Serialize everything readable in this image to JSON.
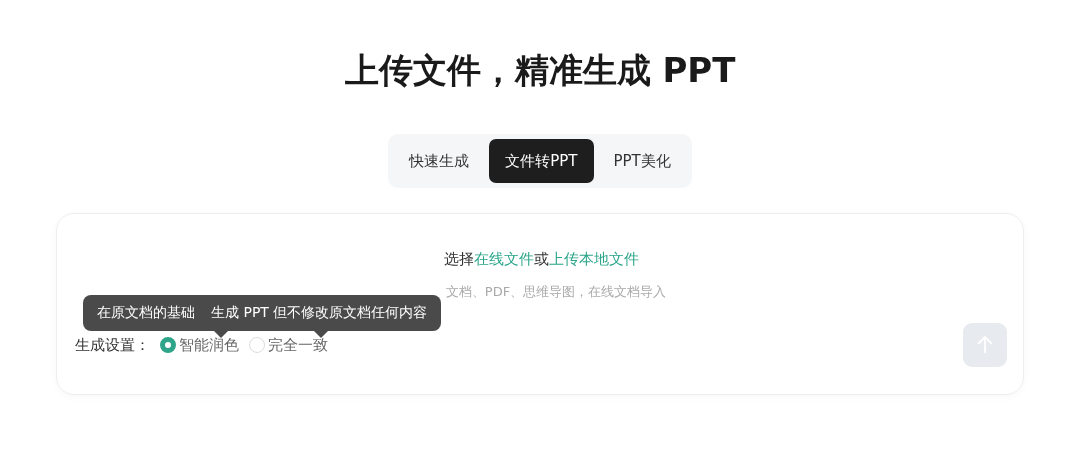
{
  "title": "上传文件，精准生成 PPT",
  "tabs": [
    {
      "label": "快速生成",
      "selected": false
    },
    {
      "label": "文件转PPT",
      "selected": true
    },
    {
      "label": "PPT美化",
      "selected": false
    }
  ],
  "upload": {
    "prefix": "选择",
    "link_online": "在线文件",
    "middle": "或",
    "link_local": "上传本地文件",
    "hint": "文档、PDF、思维导图，在线文档导入"
  },
  "tooltip": {
    "texts": [
      "在原文档的基础",
      "生成 PPT 但不修改原文档任何内容"
    ]
  },
  "settings": {
    "label": "生成设置：",
    "options": [
      {
        "label": "智能润色",
        "selected": true
      },
      {
        "label": "完全一致",
        "selected": false
      }
    ]
  },
  "send_button": {
    "disabled": true
  }
}
